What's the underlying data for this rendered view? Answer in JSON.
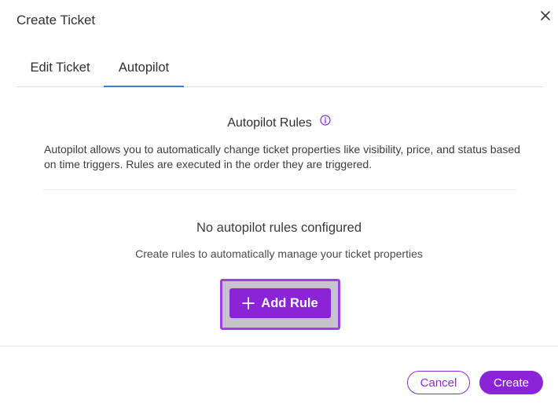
{
  "dialog": {
    "title": "Create Ticket",
    "close_icon": "close-icon"
  },
  "tabs": [
    {
      "label": "Edit Ticket",
      "active": false
    },
    {
      "label": "Autopilot",
      "active": true
    }
  ],
  "autopilot": {
    "title": "Autopilot Rules",
    "info_icon": "info-icon",
    "description": "Autopilot allows you to automatically change ticket properties like visibility, price, and status based on time triggers. Rules are executed in the order they are triggered.",
    "empty_title": "No autopilot rules configured",
    "empty_subtitle": "Create rules to automatically manage your ticket properties",
    "add_rule_label": "Add Rule",
    "add_rule_icon": "plus-icon"
  },
  "footer": {
    "cancel_label": "Cancel",
    "create_label": "Create"
  },
  "colors": {
    "accent": "#8a24d6",
    "tab_underline": "#3a7fd0",
    "highlight_border": "#a33fe0"
  }
}
